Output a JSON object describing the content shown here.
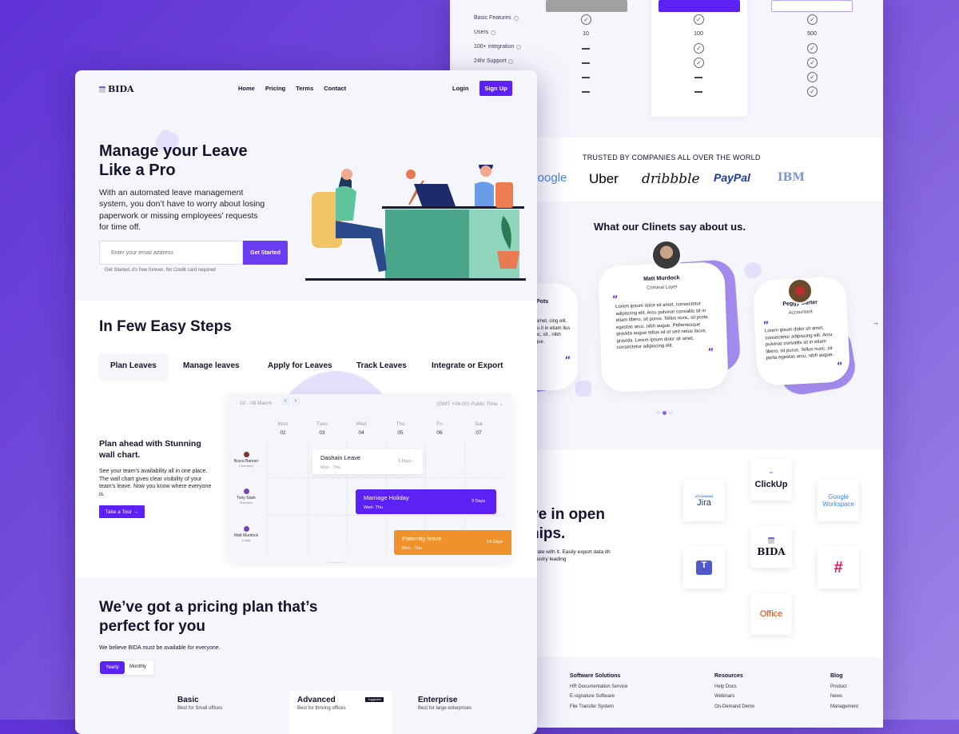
{
  "nav": {
    "brand": "BIDA",
    "links": [
      "Home",
      "Pricing",
      "Terms",
      "Contact"
    ],
    "login": "Login",
    "signup": "Sign Up"
  },
  "hero": {
    "title": "Manage your Leave Like a Pro",
    "description": "With an automated leave management system, you don’t have to worry about losing paperwork or missing employees’ requests for time off.",
    "email_placeholder": "Enter your email address",
    "cta": "Get Started",
    "fine_print": "Get Started, it's free forever. No Credit card required"
  },
  "steps": {
    "title": "In Few Easy Steps",
    "tabs": [
      "Plan Leaves",
      "Manage leaves",
      "Apply for Leaves",
      "Track Leaves",
      "Integrate or Export"
    ],
    "active_tab": 0,
    "subtitle": "Plan ahead with Stunning wall chart.",
    "description": "See your team’s availability all in one place. The wall chart gives clear visibility of your team’s leave. Now you know where everyone is.",
    "tour_button": "Take a Tour →",
    "wall_chart": {
      "range": "02 - 08 March",
      "timezone": "(GMT +06:00) Public Time",
      "days": [
        {
          "name": "Mon",
          "date": "02"
        },
        {
          "name": "Tues",
          "date": "03"
        },
        {
          "name": "Wed",
          "date": "04"
        },
        {
          "name": "Thu",
          "date": "05"
        },
        {
          "name": "Fri",
          "date": "06"
        },
        {
          "name": "Sat",
          "date": "07"
        }
      ],
      "people": [
        {
          "name": "Bruce Banner",
          "dept": "Chemistry"
        },
        {
          "name": "Tony Stark",
          "dept": "Robotics"
        },
        {
          "name": "Matt Murdock",
          "dept": "Legal"
        }
      ],
      "events": [
        {
          "title": "Dashain Leave",
          "span": "Mon - Thu",
          "days": "3 Days",
          "color": "#ffffff"
        },
        {
          "title": "Marriage Holiday",
          "span": "Wed- Thu",
          "days": "3 Days",
          "color": "#5b21f5"
        },
        {
          "title": "Paternity leave",
          "span": "Mon - Thu",
          "days": "14 Days",
          "color": "#f0922b"
        }
      ]
    }
  },
  "pricing": {
    "title": "We’ve got a pricing plan that’s perfect for you",
    "description": "We believe BIDA must be available for everyone.",
    "toggle": [
      "Yearly",
      "Monthly"
    ],
    "plans": [
      {
        "name": "Basic",
        "desc": "Best for Small offices"
      },
      {
        "name": "Advanced",
        "desc": "Best for thriving offices",
        "badge": "Suggested"
      },
      {
        "name": "Enterprise",
        "desc": "Best for large enterprises"
      }
    ],
    "features": [
      {
        "label": "Basic Features",
        "values": [
          "check",
          "check",
          "check"
        ]
      },
      {
        "label": "Users",
        "values": [
          "10",
          "100",
          "500"
        ]
      },
      {
        "label": "100+ integration",
        "values": [
          "dash",
          "check",
          "check"
        ]
      },
      {
        "label": "24hr Support",
        "values": [
          "dash",
          "check",
          "check"
        ]
      },
      {
        "label": "",
        "values": [
          "dash",
          "dash",
          "check"
        ]
      },
      {
        "label": "",
        "values": [
          "dash",
          "dash",
          "check"
        ]
      }
    ]
  },
  "trusted": {
    "title": "TRUSTED BY COMPANIES ALL OVER THE WORLD",
    "logos": [
      "Google",
      "Uber",
      "dribbble",
      "PayPal",
      "IBM"
    ]
  },
  "testimonials": {
    "title": "What our Clinets say about us.",
    "items": [
      {
        "name": "Pots",
        "role": "ant",
        "quote": "sit amet, cing elit. Arcu it in etiam llus nunc, sit , nibh augue."
      },
      {
        "name": "Matt Murdock",
        "role": "Criminal Layer",
        "quote": "Lorem ipsum dolor sit amet, consectetur adipiscing elit. Arcu pulvinar convallis sit in etiam libero, sit purus. Tellus nunc, sit porta egestas arcu, nibh augue. Pellentesque gravida augue tellus sit et sed netus lacus, gravida. Lorem ipsum dolor sit amet, consectetur adipiscing elit."
      },
      {
        "name": "Peggy Carter",
        "role": "Accountant",
        "quote": "Lorem ipsum dolor sit amet, consectetur adipiscing elit. Arcu pulvinar convallis sit in etiam libero, sit purus. Tellus nunc, sit porta egestas arcu, nibh augue."
      }
    ],
    "active_dot": 1,
    "dot_count": 3
  },
  "integrations": {
    "title_line1": "ve in open",
    "title_line2": "hips.",
    "description": "egrate with it. Easily export data ith industry leading",
    "apps": [
      "Jira",
      "ClickUp",
      "Google Workspace",
      "Teams",
      "BIDA",
      "Slack",
      "Office"
    ]
  },
  "footer": {
    "columns": [
      {
        "title": "Software Solutions",
        "links": [
          "HR Documentation Service",
          "E-signature Software",
          "File Transfer System"
        ]
      },
      {
        "title": "Resources",
        "links": [
          "Help Docs",
          "Webinars",
          "On-Demand Demo"
        ]
      },
      {
        "title": "Blog",
        "links": [
          "Product",
          "News",
          "Management"
        ]
      }
    ]
  }
}
